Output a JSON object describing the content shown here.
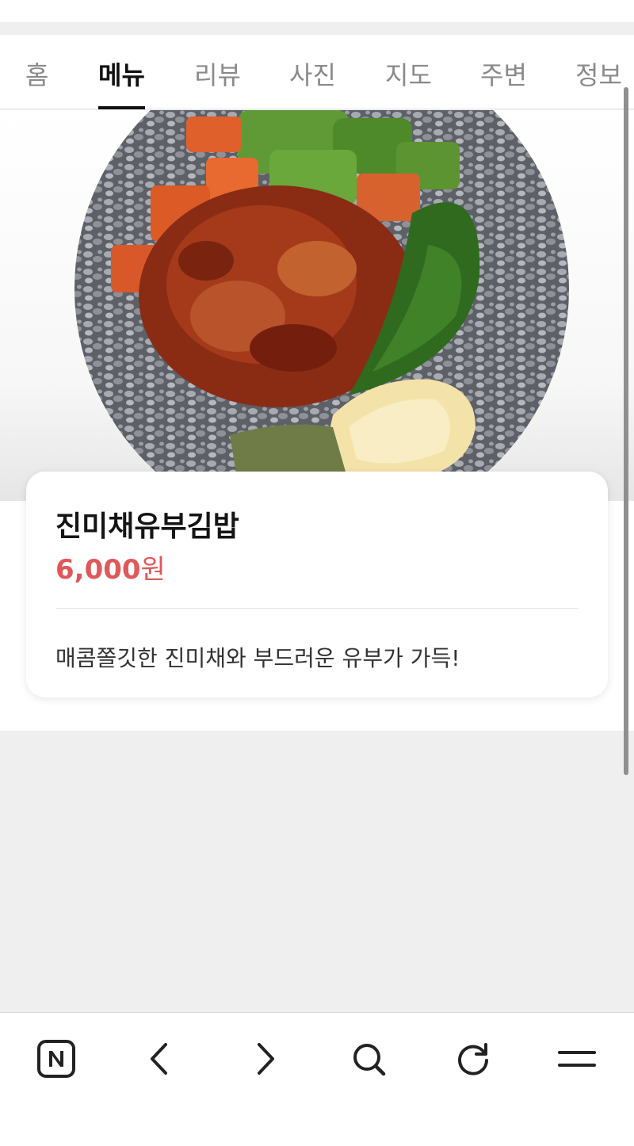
{
  "tabs": [
    {
      "label": "홈",
      "active": false
    },
    {
      "label": "메뉴",
      "active": true
    },
    {
      "label": "리뷰",
      "active": false
    },
    {
      "label": "사진",
      "active": false
    },
    {
      "label": "지도",
      "active": false
    },
    {
      "label": "주변",
      "active": false
    },
    {
      "label": "정보",
      "active": false
    }
  ],
  "menu_item": {
    "name": "진미채유부김밥",
    "price_value": "6,000",
    "price_unit": "원",
    "description": "매콤쫄깃한 진미채와 부드러운 유부가 가득!",
    "image_icon": "gimbap-photo"
  },
  "bottom_nav": {
    "items": [
      {
        "icon": "naver-home-icon"
      },
      {
        "icon": "back-icon"
      },
      {
        "icon": "forward-icon"
      },
      {
        "icon": "search-icon"
      },
      {
        "icon": "refresh-icon"
      },
      {
        "icon": "menu-icon"
      }
    ]
  },
  "colors": {
    "price": "#e0585a",
    "active_tab": "#111111",
    "inactive_tab": "#8a8a8a",
    "background": "#efefef"
  }
}
